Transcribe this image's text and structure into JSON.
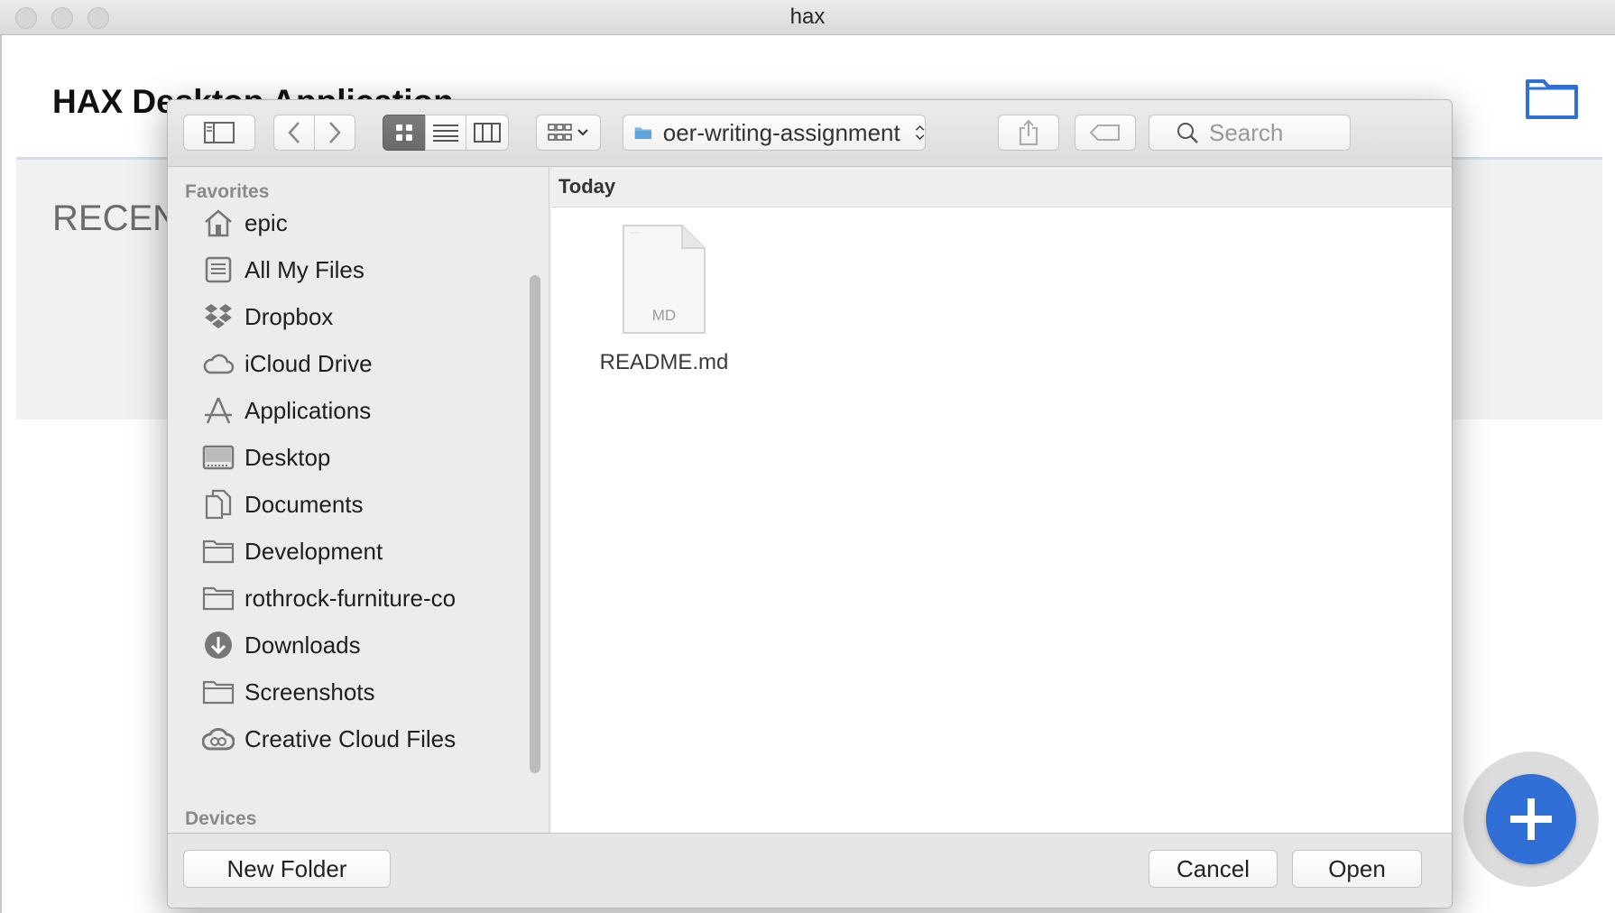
{
  "window": {
    "title": "hax"
  },
  "app": {
    "title": "HAX Desktop Application",
    "recent_label": "RECENT",
    "folder_icon": "folder-icon",
    "fab_icon": "plus-icon",
    "accent": "#2f6fd6"
  },
  "dialog": {
    "toolbar": {
      "current_folder": "oer-writing-assignment",
      "search_placeholder": "Search"
    },
    "sidebar": {
      "favorites_label": "Favorites",
      "devices_label": "Devices",
      "items": [
        {
          "label": "epic",
          "icon": "home-icon"
        },
        {
          "label": "All My Files",
          "icon": "all-files-icon"
        },
        {
          "label": "Dropbox",
          "icon": "dropbox-icon"
        },
        {
          "label": "iCloud Drive",
          "icon": "cloud-icon"
        },
        {
          "label": "Applications",
          "icon": "applications-icon"
        },
        {
          "label": "Desktop",
          "icon": "desktop-icon"
        },
        {
          "label": "Documents",
          "icon": "documents-icon"
        },
        {
          "label": "Development",
          "icon": "folder-icon"
        },
        {
          "label": "rothrock-furniture-co",
          "icon": "folder-icon"
        },
        {
          "label": "Downloads",
          "icon": "download-icon"
        },
        {
          "label": "Screenshots",
          "icon": "folder-icon"
        },
        {
          "label": "Creative Cloud Files",
          "icon": "creative-cloud-icon"
        }
      ]
    },
    "content": {
      "group_label": "Today",
      "files": [
        {
          "name": "README.md",
          "ext": "MD"
        }
      ]
    },
    "buttons": {
      "new_folder": "New Folder",
      "cancel": "Cancel",
      "open": "Open"
    }
  }
}
